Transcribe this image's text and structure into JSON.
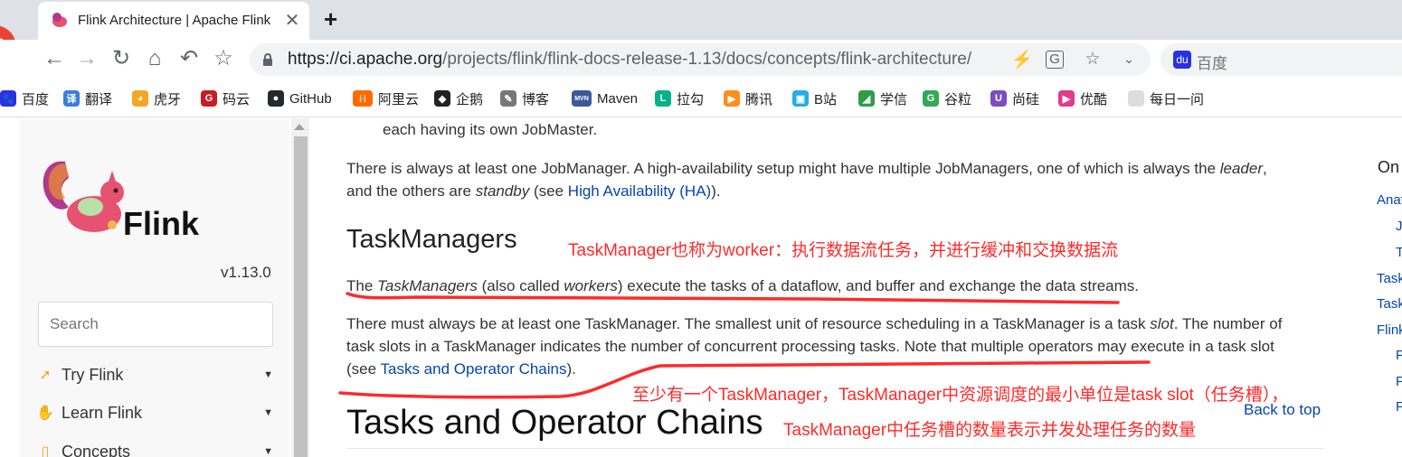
{
  "browser": {
    "tab_title": "Flink Architecture | Apache Flink",
    "tab_close": "✕",
    "new_tab": "+",
    "url_host": "https://ci.apache.org",
    "url_path": "/projects/flink/flink-docs-release-1.13/docs/concepts/flink-architecture/",
    "search_box": "百度",
    "baidu_icon_label": "du"
  },
  "bookmarks": [
    {
      "label": "百度",
      "icon": "paw-icon",
      "color": "#2932e1",
      "glyph": "🐾"
    },
    {
      "label": "翻译",
      "icon": "translate-icon",
      "color": "#3b7ddd",
      "glyph": "译"
    },
    {
      "label": "虎牙",
      "icon": "huya-icon",
      "color": "#f5a623",
      "glyph": "◕"
    },
    {
      "label": "码云",
      "icon": "gitee-icon",
      "color": "#c71d23",
      "glyph": "G"
    },
    {
      "label": "GitHub",
      "icon": "github-icon",
      "color": "#24292e",
      "glyph": "●"
    },
    {
      "label": "阿里云",
      "icon": "aliyun-icon",
      "color": "#ff6a00",
      "glyph": "[-]"
    },
    {
      "label": "企鹅",
      "icon": "penguin-icon",
      "color": "#222",
      "glyph": "◆"
    },
    {
      "label": "博客",
      "icon": "blog-icon",
      "color": "#777",
      "glyph": "✎"
    },
    {
      "label": "Maven",
      "icon": "maven-icon",
      "color": "#3c5a99",
      "glyph": "MVN"
    },
    {
      "label": "拉勾",
      "icon": "lagou-icon",
      "color": "#00b38a",
      "glyph": "L"
    },
    {
      "label": "腾讯",
      "icon": "tencent-video-icon",
      "color": "#ff8d1a",
      "glyph": "▶"
    },
    {
      "label": "B站",
      "icon": "bilibili-icon",
      "color": "#23ade5",
      "glyph": "▣"
    },
    {
      "label": "学信",
      "icon": "xuexin-icon",
      "color": "#2e9c48",
      "glyph": "◢"
    },
    {
      "label": "谷粒",
      "icon": "guli-icon",
      "color": "#34a853",
      "glyph": "G"
    },
    {
      "label": "尚硅",
      "icon": "atguigu-icon",
      "color": "#7c4dbf",
      "glyph": "U"
    },
    {
      "label": "优酷",
      "icon": "youku-icon",
      "color": "#e13a8f",
      "glyph": "▶"
    },
    {
      "label": "每日一问",
      "icon": "page-icon",
      "color": "#ddd",
      "glyph": ""
    }
  ],
  "sidebar": {
    "logo_text": "Flink",
    "version": "v1.13.0",
    "search_placeholder": "Search",
    "menu": [
      {
        "label": "Try Flink",
        "icon": "rocket-icon",
        "glyph": "🚀"
      },
      {
        "label": "Learn Flink",
        "icon": "hand-icon",
        "glyph": "✋"
      },
      {
        "label": "Concepts",
        "icon": "map-icon",
        "glyph": "▯"
      }
    ],
    "caret": "▼"
  },
  "article": {
    "line0": "each having its own JobMaster.",
    "p1_a": "There is always at least one JobManager. A high-availability setup might have multiple JobManagers, one of which is always the ",
    "p1_leader": "leader",
    "p1_b": ",",
    "p1_c": "and the others are ",
    "p1_standby": "standby",
    "p1_d": " (see ",
    "p1_link": "High Availability (HA)",
    "p1_e": ").",
    "h2": "TaskManagers",
    "p2_a": "The ",
    "p2_tm": "TaskManagers",
    "p2_b": " (also called ",
    "p2_workers": "workers",
    "p2_c": ") execute the tasks of a dataflow, and buffer and exchange the data streams.",
    "p3_a": "There must always be at least one TaskManager. The smallest unit of resource scheduling in a TaskManager is a task ",
    "p3_slot": "slot",
    "p3_b": ". The number of",
    "p3_line2": "task slots in a TaskManager indicates the number of concurrent processing tasks. Note that multiple operators may execute in a task slot",
    "p3_c": "(see ",
    "p3_link": "Tasks and Operator Chains",
    "p3_d": ").",
    "h1": "Tasks and Operator Chains",
    "back_to_top": "Back to top"
  },
  "annotations": {
    "note1": "TaskManager也称为worker：执行数据流任务，并进行缓冲和交换数据流",
    "note2": "至少有一个TaskManager，TaskManager中资源调度的最小单位是task slot（任务槽），",
    "note3": "TaskManager中任务槽的数量表示并发处理任务的数量",
    "color": "#ff2a2a"
  },
  "toc": {
    "title": "On",
    "items": [
      "Anat",
      "J",
      "T",
      "Task",
      "Task",
      "Flink",
      "F",
      "F",
      "F"
    ]
  }
}
